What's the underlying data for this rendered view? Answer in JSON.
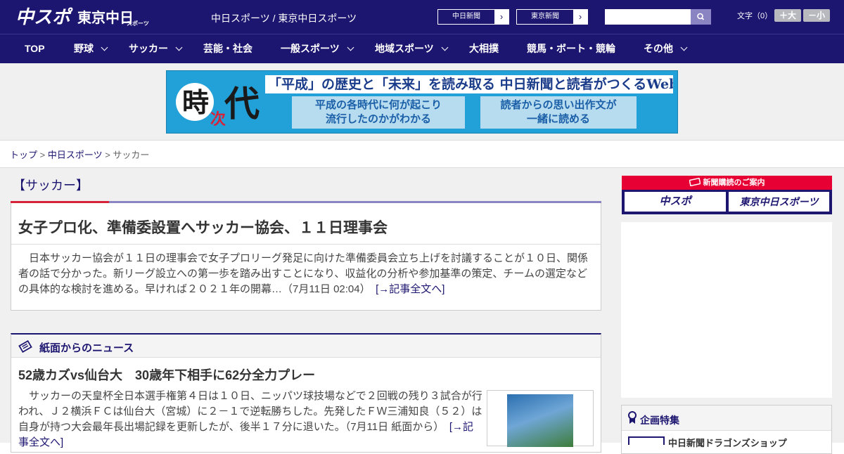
{
  "header": {
    "site_title": "中日スポーツ / 東京中日スポーツ",
    "paper_links": [
      {
        "label": "中日新聞"
      },
      {
        "label": "東京新聞"
      }
    ],
    "search_placeholder": "",
    "font_size_label": "文字（0）",
    "font_size_buttons": {
      "bigger": "＋大",
      "smaller": "－小"
    },
    "logo": {
      "chusupo": "中スポ",
      "tokyo": "東京中日",
      "sports": "スポーツ"
    }
  },
  "nav": {
    "items": [
      {
        "label": "TOP",
        "dropdown": false
      },
      {
        "label": "野球",
        "dropdown": true
      },
      {
        "label": "サッカー",
        "dropdown": true
      },
      {
        "label": "芸能・社会",
        "dropdown": false
      },
      {
        "label": "一般スポーツ",
        "dropdown": true
      },
      {
        "label": "地域スポーツ",
        "dropdown": true
      },
      {
        "label": "大相撲",
        "dropdown": false
      },
      {
        "label": "競馬・ボート・競輪",
        "dropdown": false
      },
      {
        "label": "その他",
        "dropdown": true
      }
    ]
  },
  "banner": {
    "kanji_main": "時",
    "kanji_sub": "次",
    "kanji_end": "代",
    "headline": "「平成」の歴史と「未来」を読み取る 中日新聞と読者がつくるWebサイト",
    "box_left": [
      "平成の各時代に何が起こり",
      "流行したのかがわかる"
    ],
    "box_right": [
      "読者からの思い出作文が",
      "一緒に読める"
    ]
  },
  "breadcrumbs": {
    "top": "トップ",
    "sep": " > ",
    "section": "中日スポーツ",
    "current": "サッカー"
  },
  "category_title": "【サッカー】",
  "lead_article": {
    "title": "女子プロ化、準備委設置へサッカー協会、１１日理事会",
    "body": "日本サッカー協会が１１日の理事会で女子プロリーグ発足に向けた準備委員会立ち上げを討議することが１０日、関係者の話で分かった。新リーグ設立への第一歩を踏み出すことになり、収益化の分析や参加基準の策定、チームの選定などの具体的な検討を進める。早ければ２０２１年の開幕…（7月11日 02:04）",
    "more": "[→記事全文へ]"
  },
  "news_section": {
    "label": "紙面からのニュース",
    "article_title": "52歳カズvs仙台大　30歳年下相手に62分全力プレー",
    "article_body": "サッカーの天皇杯全日本選手権第４日は１０日、ニッパツ球技場などで２回戦の残り３試合が行われ、Ｊ２横浜ＦＣは仙台大（宮城）に２－１で逆転勝ちした。先発したＦＷ三浦知良（５２）は自身が持つ大会最年長出場記録を更新したが、後半１７分に退いた。（7月11日 紙面から）",
    "more": "[→記事全文へ]"
  },
  "sidebar": {
    "subscribe_header": "新聞購読のご案内",
    "subscribe_buttons": [
      "中スポ",
      "東京中日スポーツ"
    ],
    "feature_label": "企画特集",
    "feature_item": "中日新聞ドラゴンズショップ"
  }
}
